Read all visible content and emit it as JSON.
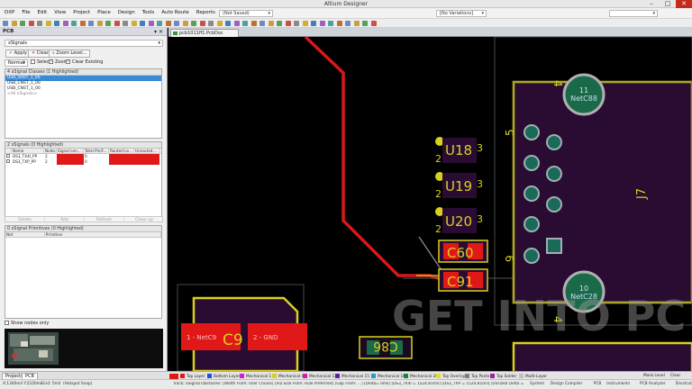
{
  "window": {
    "title": "Altium Designer"
  },
  "menu": [
    "DXP",
    "File",
    "Edit",
    "View",
    "Project",
    "Place",
    "Design",
    "Tools",
    "Auto Route",
    "Reports",
    "Window",
    "Help"
  ],
  "menubar_combos": {
    "saved": "(Not Saved)",
    "variations": "[No Variations]"
  },
  "panel": {
    "title": "PCB",
    "type_select": "xSignals",
    "apply": "Apply",
    "clear": "Clear",
    "zoom_level": "Zoom Level...",
    "mode_select": "Normal",
    "opt_select": "Select",
    "opt_zoom": "Zoom",
    "opt_clear_existing": "Clear Existing",
    "classes_header": "4 xSignal Classes (1 Highlighted)",
    "classes": [
      "USB_D00T_1_00",
      "USB_CNST_1_00",
      "USB_CNST_1_00",
      "<All xSignals>"
    ],
    "signals_header": "2 xSignals (0 Highlighted)",
    "signal_cols": [
      "",
      "Name",
      "Node...",
      "Signal Len...",
      "Total Pin/F...",
      "Routed Le...",
      "Unrouted..."
    ],
    "signal_rows": [
      {
        "name": "DS3_TX4I_PP",
        "node": "2",
        "total": "0"
      },
      {
        "name": "DS3_TXP_PP",
        "node": "2",
        "total": "0"
      }
    ],
    "grid_buttons": [
      "Delete",
      "Add",
      "Refresh",
      "Clean up"
    ],
    "primitives_header": "0 xSignal Primitives (0 Highlighted)",
    "prim_cols": [
      "Net",
      "Primitive"
    ],
    "show_nodes_only": "Show nodes only"
  },
  "bottom_tabs": [
    "Projects",
    "PCB"
  ],
  "document_tab": "pcb1011ff1.PcbDoc",
  "board": {
    "u_labels": [
      "U18",
      "U19",
      "U20"
    ],
    "pin_1": "1",
    "pin_2": "2",
    "pin_3": "3",
    "pin_4": "4",
    "pin_5": "5",
    "pin_9": "9",
    "pin_10": "10",
    "pin_11": "11",
    "designator_c60": "C60",
    "designator_c91": "C91",
    "designator_c86": "C86",
    "designator_c9": "C9",
    "designator_j7": "J7",
    "net_c88": "NetC88",
    "net_c28": "NetC28",
    "pad_netc9": "1 - NetC9",
    "pad_gnd": "2 - GND",
    "watermark": "GET INTO PC"
  },
  "layers": [
    {
      "name": "Top Layer",
      "color": "#e01818"
    },
    {
      "name": "Bottom Layer",
      "color": "#2050d8"
    },
    {
      "name": "Mechanical 1",
      "color": "#d020d0"
    },
    {
      "name": "Mechanical 4",
      "color": "#d8d020"
    },
    {
      "name": "Mechanical 13",
      "color": "#d020a0"
    },
    {
      "name": "Mechanical 15",
      "color": "#6020a0"
    },
    {
      "name": "Mechanical 16",
      "color": "#20a0c0"
    },
    {
      "name": "Mechanical 20",
      "color": "#208040"
    },
    {
      "name": "Top Overlay",
      "color": "#e0e020"
    },
    {
      "name": "Top Paste",
      "color": "#808080"
    },
    {
      "name": "Top Solder",
      "color": "#a020a0"
    },
    {
      "name": "Multi-Layer",
      "color": "#c0c0c0"
    }
  ],
  "status": {
    "coords": "X:1340mil Y:2100mil",
    "grid": "Grid: 5mil",
    "snap": "(Hotspot Snap)",
    "message": "Track: xSignal Obstacles: [Width From: User Choice] [Via Size From: Rule Preferred] [Gap From: ...] [Delta= 0mil] [DS3_TX4I = 1524.81mil] [DS3_TXP = 1524.81mil] [Unsized Delta = 0mil]",
    "right_items": [
      "System",
      "Design Compiler",
      "PCB",
      "Instruments",
      "PCB Analyzer",
      "Shortcuts",
      ">>"
    ],
    "mask_level": "Mask Level",
    "clear": "Clear"
  }
}
